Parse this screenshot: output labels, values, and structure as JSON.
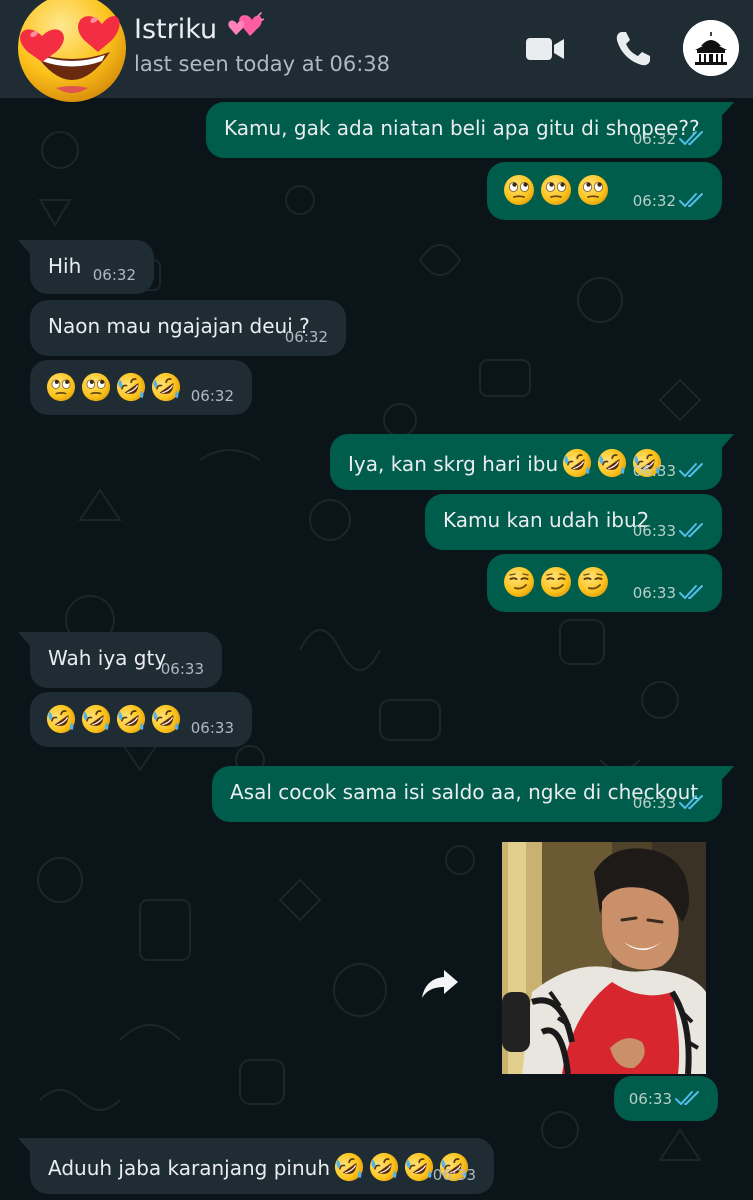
{
  "header": {
    "contact_name": "Istriku",
    "status": "last seen today at 06:38",
    "icons": [
      "smiling-face-with-heart-eyes-emoji",
      "two-hearts-emoji",
      "video-call-icon",
      "voice-call-icon",
      "mosque-profile-icon"
    ]
  },
  "colors": {
    "outgoing_bubble": "#005c4b",
    "incoming_bubble": "#202c33",
    "header": "#1f2c33",
    "background": "#0b1418",
    "read_ticks": "#53bdeb"
  },
  "messages": [
    {
      "dir": "out",
      "text": "Kamu, gak ada niatan beli apa gitu di shopee??",
      "time": "06:32",
      "status": "read"
    },
    {
      "dir": "out",
      "emoji": [
        "face-with-rolling-eyes",
        "face-with-rolling-eyes",
        "face-with-rolling-eyes"
      ],
      "time": "06:32",
      "status": "read"
    },
    {
      "dir": "in",
      "text": "Hih",
      "time": "06:32"
    },
    {
      "dir": "in",
      "text": "Naon mau ngajajan deui ?",
      "time": "06:32"
    },
    {
      "dir": "in",
      "emoji": [
        "face-with-rolling-eyes",
        "face-with-rolling-eyes",
        "rolling-on-the-floor-laughing",
        "rolling-on-the-floor-laughing"
      ],
      "time": "06:32"
    },
    {
      "dir": "out",
      "text": "Iya, kan skrg hari ibu",
      "emoji": [
        "rolling-on-the-floor-laughing",
        "rolling-on-the-floor-laughing",
        "rolling-on-the-floor-laughing"
      ],
      "time": "06:33",
      "status": "read"
    },
    {
      "dir": "out",
      "text": "Kamu kan udah ibu2",
      "time": "06:33",
      "status": "read"
    },
    {
      "dir": "out",
      "emoji": [
        "smirking-face",
        "smirking-face",
        "smirking-face"
      ],
      "time": "06:33",
      "status": "read"
    },
    {
      "dir": "in",
      "text": "Wah iya gty",
      "time": "06:33"
    },
    {
      "dir": "in",
      "emoji": [
        "rolling-on-the-floor-laughing",
        "rolling-on-the-floor-laughing",
        "rolling-on-the-floor-laughing",
        "rolling-on-the-floor-laughing"
      ],
      "time": "06:33"
    },
    {
      "dir": "out",
      "text": "Asal cocok sama isi saldo aa, ngke di checkout",
      "time": "06:33",
      "status": "read"
    },
    {
      "dir": "out",
      "type": "image",
      "image": "laughing-man-in-red-shirt-photo",
      "time": "06:33",
      "status": "read"
    },
    {
      "dir": "in",
      "text": "Aduuh jaba karanjang pinuh",
      "emoji": [
        "rolling-on-the-floor-laughing",
        "rolling-on-the-floor-laughing",
        "rolling-on-the-floor-laughing",
        "rolling-on-the-floor-laughing"
      ],
      "time": "06:33"
    }
  ]
}
